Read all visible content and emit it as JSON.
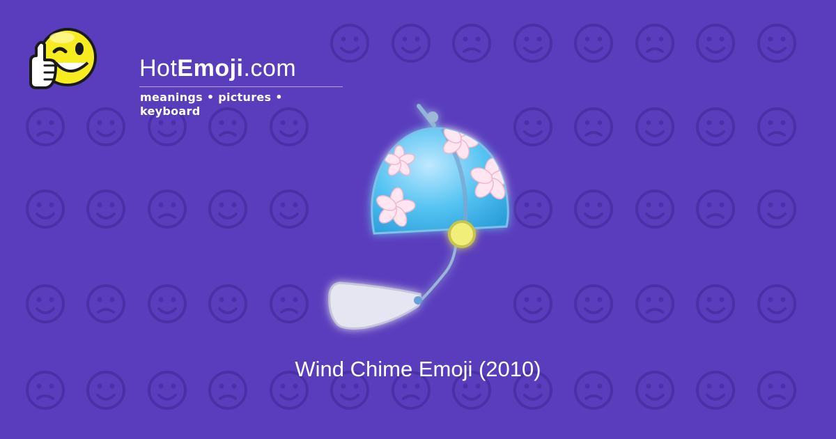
{
  "brand": {
    "name_prefix": "Hot",
    "name_bold": "Emoji",
    "name_suffix": ".com",
    "tagline": "meanings • pictures • keyboard"
  },
  "caption": "Wind Chime Emoji (2010)",
  "background_icons": [
    "smiling-face",
    "winking-face",
    "kissing-face",
    "hearts",
    "smiling-face",
    "persevering-face",
    "ok-hand",
    "expressionless-face",
    "eyes",
    "unamused-face",
    "relieved-face",
    "face-with-hands",
    "recycle-symbol",
    "raising-hands",
    "musical-notes",
    "see-no-evil-monkey",
    "sleeping-face",
    "disappointed-face",
    "grinning-face",
    "sparkles",
    "grinning-face",
    "striped-heart",
    "broken-heart",
    "confused-face",
    "striped-heart",
    "tongue-face",
    "sad-face",
    "smirk-face",
    "heart-with-arrow",
    "weary-face",
    "small-hearts",
    "heart",
    "monkey",
    "scream-face",
    "smiling-devil",
    "angry-face",
    "left-arrow",
    "fire",
    "fist",
    "party-popper",
    "squinting-face",
    "rose",
    "sun",
    "flexed-biceps",
    "striped-heart",
    "check-mark",
    "laughing-face",
    "new-moon-face",
    "cat-face",
    "waving-hand",
    "grimacing-face",
    "camera",
    "laughing-face",
    "striped-heart",
    "smiling-face",
    "beating-heart",
    "kissing-face"
  ],
  "colors": {
    "background": "#5a3dbd",
    "pattern_icon": "#4b2fa6",
    "chime_bell": "#3fb6ea",
    "chime_blossom": "#f8c8dc",
    "chime_clapper": "#f1ee7a",
    "chime_paper": "#e6e6f2",
    "logo_face": "#f7ec1f"
  }
}
